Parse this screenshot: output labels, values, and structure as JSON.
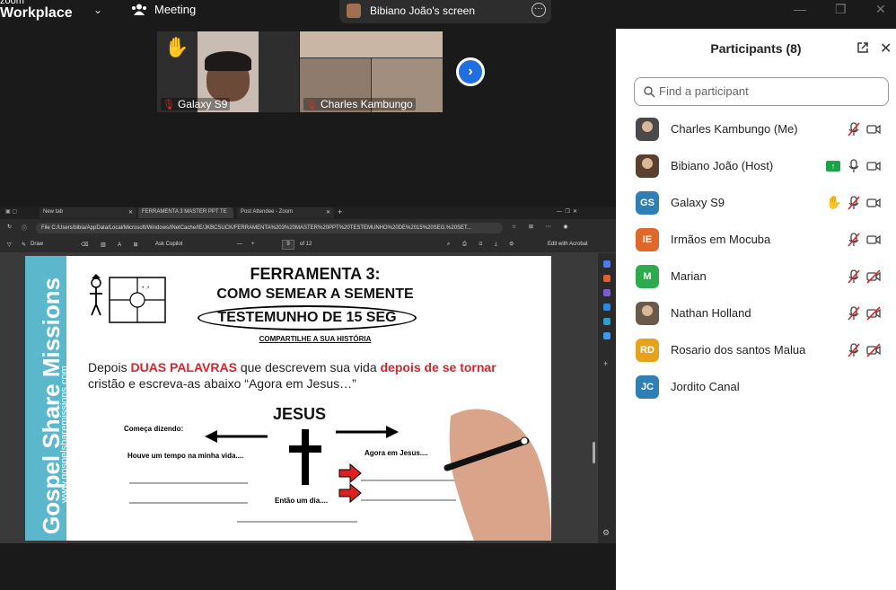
{
  "app": {
    "brand_top": "zoom",
    "brand_main": "Workplace",
    "meeting_label": "Meeting"
  },
  "share": {
    "label": "Bibiano João's screen"
  },
  "videos": [
    {
      "name": "Galaxy S9"
    },
    {
      "name": "Charles Kambungo"
    }
  ],
  "browser": {
    "tabs": [
      "New tab",
      "FERRAMENTA 3 MASTER PPT TE",
      "Post Attendee - Zoom"
    ],
    "address": "File   C:/Users/bibia/AppData/Local/Microsoft/Windows/INetCache/IE/JKBCSUCK/FERRAMENTA%203%20MASTER%20PPT%20TESTEMUNHO%20DE%2015%20SEG.%20SET...",
    "toolbar": {
      "draw": "Draw",
      "copilot": "Ask Copilot",
      "page": "9",
      "of_pages": "of 12",
      "edit": "Edit with Acrobat"
    }
  },
  "slide": {
    "side_brand": "Gospel Share Missions",
    "side_url": "www.gospelsharemissions.com",
    "title1": "FERRAMENTA 3:",
    "title2": "COMO SEMEAR A SEMENTE",
    "title3": "TESTEMUNHO DE 15 SEG",
    "subtitle": "COMPARTILHE A SUA HISTÓRIA",
    "instr_a": "Depois ",
    "instr_red1": "DUAS PALAVRAS",
    "instr_b": " que descrevem sua vida ",
    "instr_red2": "depois de se tornar",
    "instr_line2": "cristão e escreva-as abaixo “Agora em Jesus…”",
    "jesus": "JESUS",
    "comeca": "Começa dizendo:",
    "houve": "Houve um tempo na minha vida....",
    "agora": "Agora em Jesus....",
    "entao": "Então um dia...."
  },
  "participants": {
    "title": "Participants (8)",
    "search_placeholder": "Find a participant",
    "list": [
      {
        "name": "Charles Kambungo (Me)",
        "initials": "",
        "color": "#4a4a4a",
        "photo": true
      },
      {
        "name": "Bibiano João (Host)",
        "initials": "",
        "color": "#5a4030",
        "photo": true
      },
      {
        "name": "Galaxy S9",
        "initials": "GS",
        "color": "#2f7fb5"
      },
      {
        "name": "Irmãos em Mocuba",
        "initials": "IE",
        "color": "#e0672a"
      },
      {
        "name": "Marian",
        "initials": "M",
        "color": "#2eaa4e"
      },
      {
        "name": "Nathan Holland",
        "initials": "",
        "color": "#6b5a4a",
        "photo": true
      },
      {
        "name": "Rosario dos santos Malua",
        "initials": "RD",
        "color": "#e5a21a"
      },
      {
        "name": "Jordito Canal",
        "initials": "JC",
        "color": "#2f7fb5"
      }
    ]
  }
}
